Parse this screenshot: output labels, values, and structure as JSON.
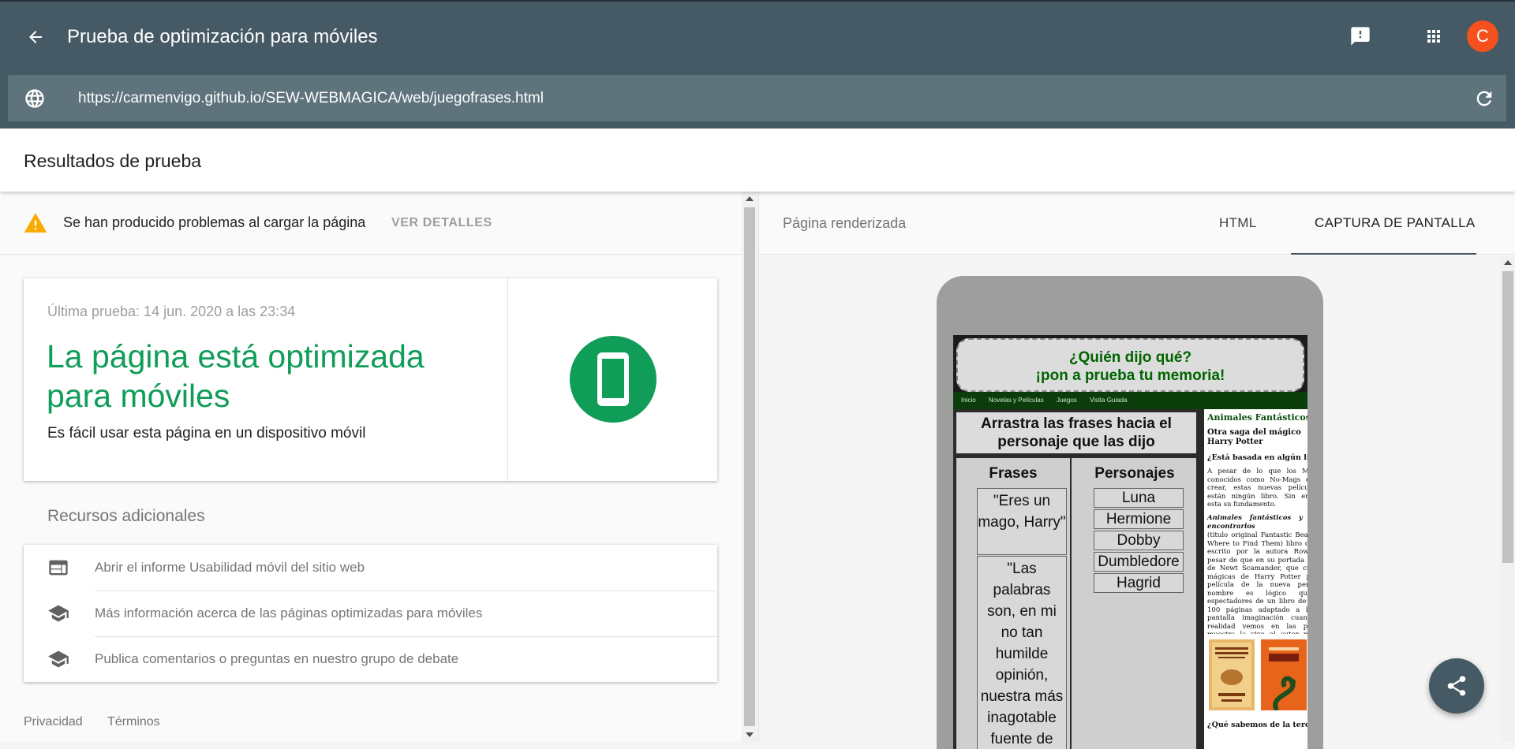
{
  "app": {
    "title": "Prueba de optimización para móviles",
    "url": "https://carmenvigo.github.io/SEW-WEBMAGICA/web/juegofrases.html",
    "avatar_letter": "C",
    "accent_color": "#455a64",
    "icons": {
      "back": "arrow-back-icon",
      "feedback": "feedback-icon",
      "apps": "apps-grid-icon",
      "globe": "globe-icon",
      "refresh": "refresh-icon",
      "share": "share-icon"
    }
  },
  "results": {
    "title": "Resultados de prueba"
  },
  "warning": {
    "text": "Se han producido problemas al cargar la página",
    "link": "VER DETALLES"
  },
  "result_card": {
    "last_test": "Última prueba: 14 jun. 2020 a las 23:34",
    "verdict": "La página está optimizada para móviles",
    "subtext": "Es fácil usar esta página en un dispositivo móvil",
    "verdict_color": "#0f9d58"
  },
  "resources": {
    "title": "Recursos adicionales",
    "items": [
      {
        "label": "Abrir el informe Usabilidad móvil del sitio web",
        "icon": "web-report-icon"
      },
      {
        "label": "Más información acerca de las páginas optimizadas para móviles",
        "icon": "school-icon"
      },
      {
        "label": "Publica comentarios o preguntas en nuestro grupo de debate",
        "icon": "school-icon"
      }
    ]
  },
  "footer": {
    "privacy": "Privacidad",
    "terms": "Términos"
  },
  "rendered": {
    "title": "Página renderizada",
    "tabs": [
      "HTML",
      "CAPTURA DE PANTALLA"
    ],
    "active_tab": "CAPTURA DE PANTALLA"
  },
  "site_preview": {
    "banner_line1": "¿Quién dijo qué?",
    "banner_line2": "¡pon a prueba tu memoria!",
    "nav": [
      "Inicio",
      "Novelas y Películas",
      "Juegos",
      "Visita Guiada"
    ],
    "instructions": "Arrastra las frases hacia el personaje que las dijo",
    "frases_header": "Frases",
    "personajes_header": "Personajes",
    "frases": [
      "\"Eres un mago, Harry\"",
      "\"Las palabras son, en mi no tan humilde opinión, nuestra más inagotable fuente de"
    ],
    "personajes": [
      "Luna",
      "Hermione",
      "Dobby",
      "Dumbledore",
      "Hagrid"
    ],
    "sidebar": {
      "title": "Animales Fantásticos",
      "subtitle": "Otra saga del mágico Harry Potter",
      "q1": "¿Está basada en algún libro?",
      "p1": "A pesar de lo que los Muggles, conocidos como No-Mags en este crear, estas nuevas películas no están ningún libro. Sin embargo, esta su fundamento.",
      "p2_italic": "Animales fantásticos y dónde encontrarlos",
      "p2": "(título original Fantastic Beasts and Where to Find Them) libro de 2001 escrito por la autora Rowling, a pesar de que en su portada nombre de Newt Scamander, que criaturas mágicas de Harry Potter primera película de la nueva pentalogía nombre es lógico que los espectadores de un libro de apenas 100 páginas adaptado a la gran pantalla imaginación cuando, en realidad vemos en las películas muestra la vive el autor mientras escribe su",
      "q2": "¿Qué sabemos de la tercera?"
    }
  }
}
